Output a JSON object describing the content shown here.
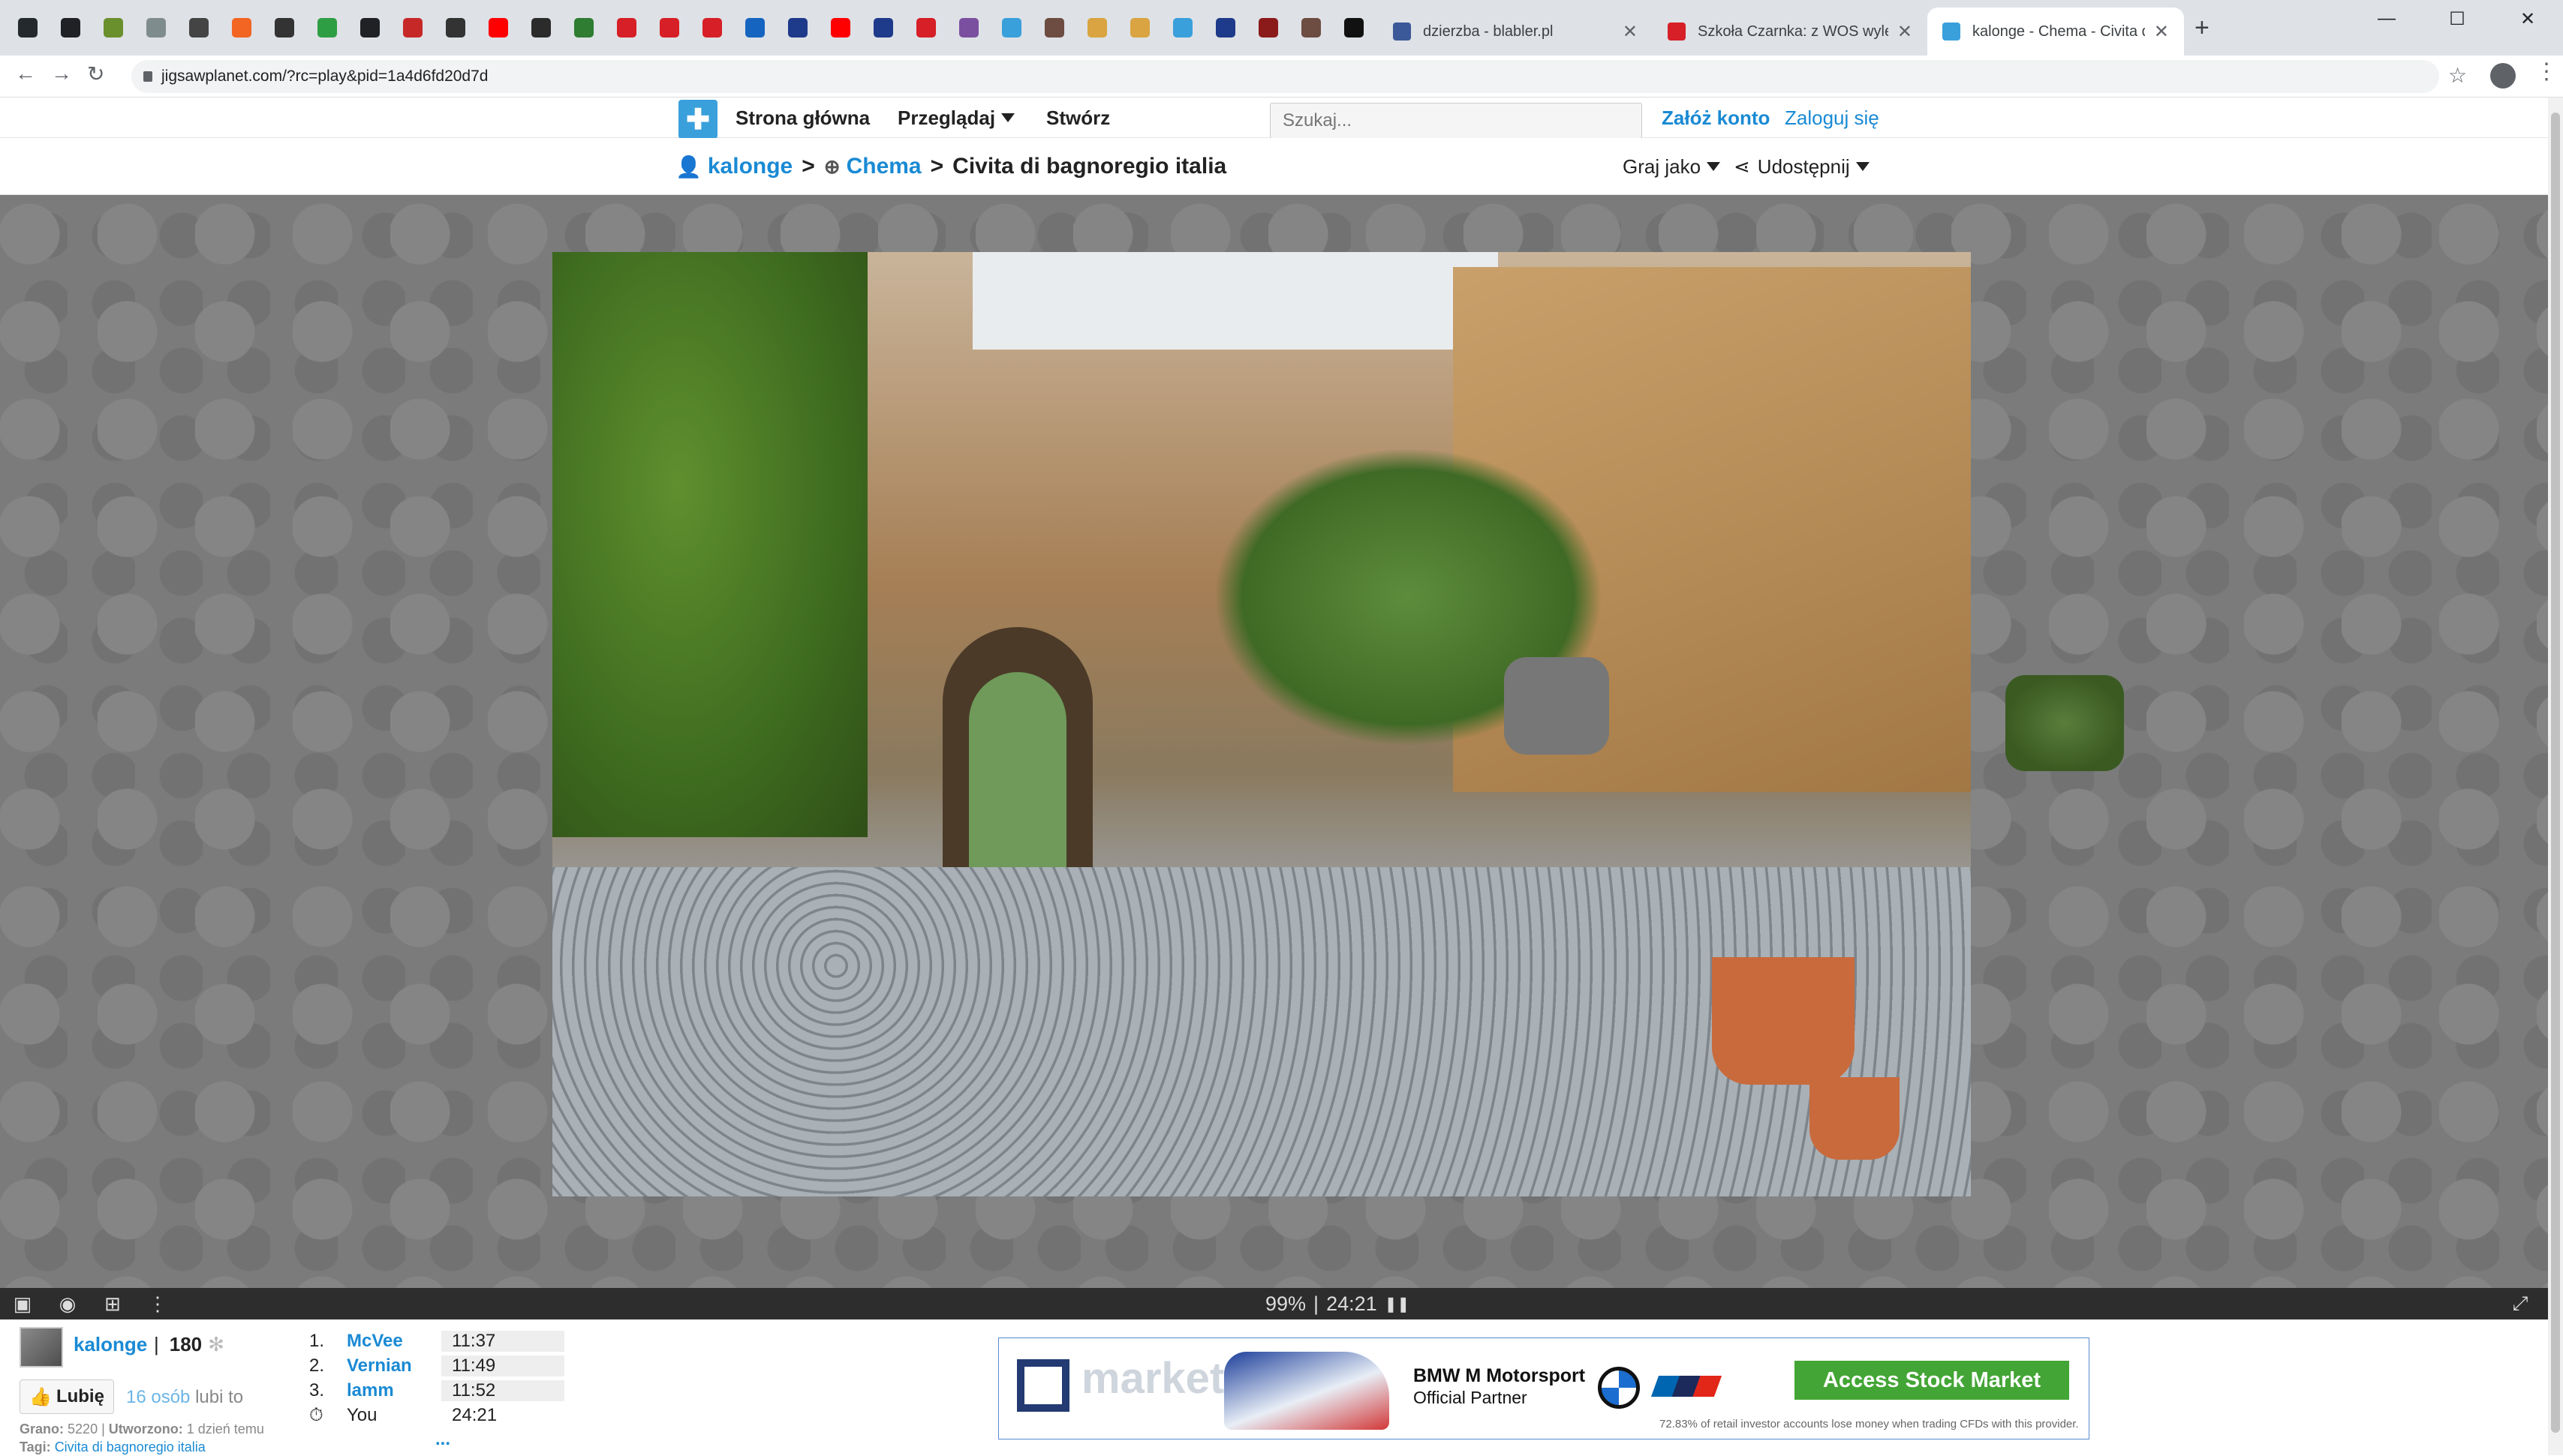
{
  "browser": {
    "pinned_tabs": [
      {
        "icon": "github-icon",
        "color": "#24292e"
      },
      {
        "icon": "gmail-icon",
        "color": "#202124"
      },
      {
        "icon": "bookmark-icon",
        "color": "#6a8f2d"
      },
      {
        "icon": "wreath-icon",
        "color": "#7f8c8d"
      },
      {
        "icon": "co-icon",
        "color": "#444444"
      },
      {
        "icon": "orange-icon",
        "color": "#f26522"
      },
      {
        "icon": "grid-icon",
        "color": "#333333"
      },
      {
        "icon": "n-icon",
        "color": "#2e9e44"
      },
      {
        "icon": "shield-icon",
        "color": "#202124"
      },
      {
        "icon": "bc-icon",
        "color": "#c62828"
      },
      {
        "icon": "cube-icon",
        "color": "#333333"
      },
      {
        "icon": "youtube-icon",
        "color": "#ff0000"
      },
      {
        "icon": "sc-icon",
        "color": "#2b2b2b"
      },
      {
        "icon": "nu-icon",
        "color": "#2e7d32"
      },
      {
        "icon": "red-doc-icon",
        "color": "#d61f26"
      },
      {
        "icon": "red-doc-icon",
        "color": "#d61f26"
      },
      {
        "icon": "red-doc-icon",
        "color": "#d61f26"
      },
      {
        "icon": "globe-icon",
        "color": "#1565c0"
      },
      {
        "icon": "blue-seal-icon",
        "color": "#1e3a8a"
      },
      {
        "icon": "youtube-icon",
        "color": "#ff0000"
      },
      {
        "icon": "blue-seal-icon",
        "color": "#1e3a8a"
      },
      {
        "icon": "red-doc-icon",
        "color": "#d61f26"
      },
      {
        "icon": "bird-icon",
        "color": "#7b4fa0"
      },
      {
        "icon": "fish-icon",
        "color": "#3aa0dc"
      },
      {
        "icon": "person-icon",
        "color": "#6d4c41"
      },
      {
        "icon": "hand-icon",
        "color": "#d9a441"
      },
      {
        "icon": "hand-icon",
        "color": "#d9a441"
      },
      {
        "icon": "blue-square-icon",
        "color": "#3aa0dc"
      },
      {
        "icon": "emblem-icon",
        "color": "#1e3a8a"
      },
      {
        "icon": "red-emblem-icon",
        "color": "#8b1a1a"
      },
      {
        "icon": "person-icon",
        "color": "#6d4c41"
      },
      {
        "icon": "d-icon",
        "color": "#111111"
      }
    ],
    "tabs": [
      {
        "title": "dzierzba - blabler.pl",
        "color": "#3b5998"
      },
      {
        "title": "Szkoła Czarnka: z WOS wyleciało",
        "color": "#d61f26"
      },
      {
        "title": "kalonge - Chema - Civita di bagn",
        "color": "#3aa0dc"
      }
    ],
    "url": "jigsawplanet.com/?rc=play&pid=1a4d6fd20d7d",
    "window_controls": {
      "minimize": "—",
      "maximize": "☐",
      "close": "✕"
    },
    "new_tab": "+"
  },
  "header": {
    "home": "Strona główna",
    "browse": "Przeglądaj",
    "create": "Stwórz",
    "search_placeholder": "Szukaj...",
    "signup": "Załóż konto",
    "login": "Zaloguj się"
  },
  "titlebar": {
    "author": "kalonge",
    "sep": ">",
    "owner": "Chema",
    "puzzle_title": "Civita di bagnoregio italia",
    "play_as": "Graj jako",
    "share": "Udostępnij"
  },
  "statusbar": {
    "progress": "99%",
    "divider": "|",
    "timer": "24:21",
    "pause_icon": "pause-icon",
    "progress_value": 0.99
  },
  "footer": {
    "user": "kalonge",
    "divider": "|",
    "score": "180",
    "like_button": "Lubię",
    "likes_count": "16 osób",
    "likes_suffix": "lubi to",
    "played_label": "Grano:",
    "played_value": "5220",
    "created_label": "Utworzono:",
    "created_value": "1 dzień temu",
    "tags_label": "Tagi:",
    "tags_value": "Civita di bagnoregio italia",
    "leaderboard": [
      {
        "rank": "1.",
        "name": "McVee",
        "time": "11:37"
      },
      {
        "rank": "2.",
        "name": "Vernian",
        "time": "11:49"
      },
      {
        "rank": "3.",
        "name": "lamm",
        "time": "11:52"
      },
      {
        "rank": "",
        "name": "You",
        "time": "24:21"
      }
    ],
    "more": "..."
  },
  "ad": {
    "word": "market",
    "title": "BMW M Motorsport",
    "subtitle": "Official Partner",
    "cta": "Access Stock Market",
    "disclaimer": "72.83% of retail investor accounts lose money when trading CFDs with this provider."
  }
}
